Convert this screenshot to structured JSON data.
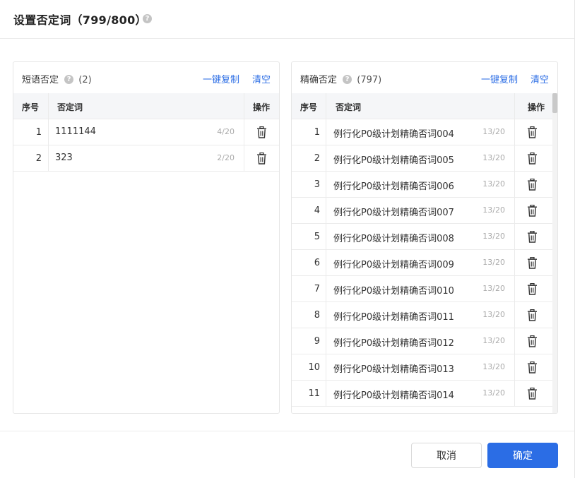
{
  "dialog": {
    "title": "设置否定词（799/800）",
    "help_icon": "question-circle-icon"
  },
  "phrase_panel": {
    "title": "短语否定",
    "count": "(2)",
    "copy_label": "一键复制",
    "clear_label": "清空",
    "columns": {
      "index": "序号",
      "word": "否定词",
      "action": "操作"
    },
    "rows": [
      {
        "index": "1",
        "word": "1111144",
        "length": "4/20"
      },
      {
        "index": "2",
        "word": "323",
        "length": "2/20"
      }
    ]
  },
  "exact_panel": {
    "title": "精确否定",
    "count": "(797)",
    "copy_label": "一键复制",
    "clear_label": "清空",
    "columns": {
      "index": "序号",
      "word": "否定词",
      "action": "操作"
    },
    "rows": [
      {
        "index": "1",
        "word": "例行化P0级计划精确否词004",
        "length": "13/20"
      },
      {
        "index": "2",
        "word": "例行化P0级计划精确否词005",
        "length": "13/20"
      },
      {
        "index": "3",
        "word": "例行化P0级计划精确否词006",
        "length": "13/20"
      },
      {
        "index": "4",
        "word": "例行化P0级计划精确否词007",
        "length": "13/20"
      },
      {
        "index": "5",
        "word": "例行化P0级计划精确否词008",
        "length": "13/20"
      },
      {
        "index": "6",
        "word": "例行化P0级计划精确否词009",
        "length": "13/20"
      },
      {
        "index": "7",
        "word": "例行化P0级计划精确否词010",
        "length": "13/20"
      },
      {
        "index": "8",
        "word": "例行化P0级计划精确否词011",
        "length": "13/20"
      },
      {
        "index": "9",
        "word": "例行化P0级计划精确否词012",
        "length": "13/20"
      },
      {
        "index": "10",
        "word": "例行化P0级计划精确否词013",
        "length": "13/20"
      },
      {
        "index": "11",
        "word": "例行化P0级计划精确否词014",
        "length": "13/20"
      }
    ]
  },
  "footer": {
    "cancel_label": "取消",
    "confirm_label": "确定"
  },
  "colors": {
    "accent": "#2b6de5",
    "header_bg": "#f5f6f8",
    "border": "#ebebeb"
  }
}
